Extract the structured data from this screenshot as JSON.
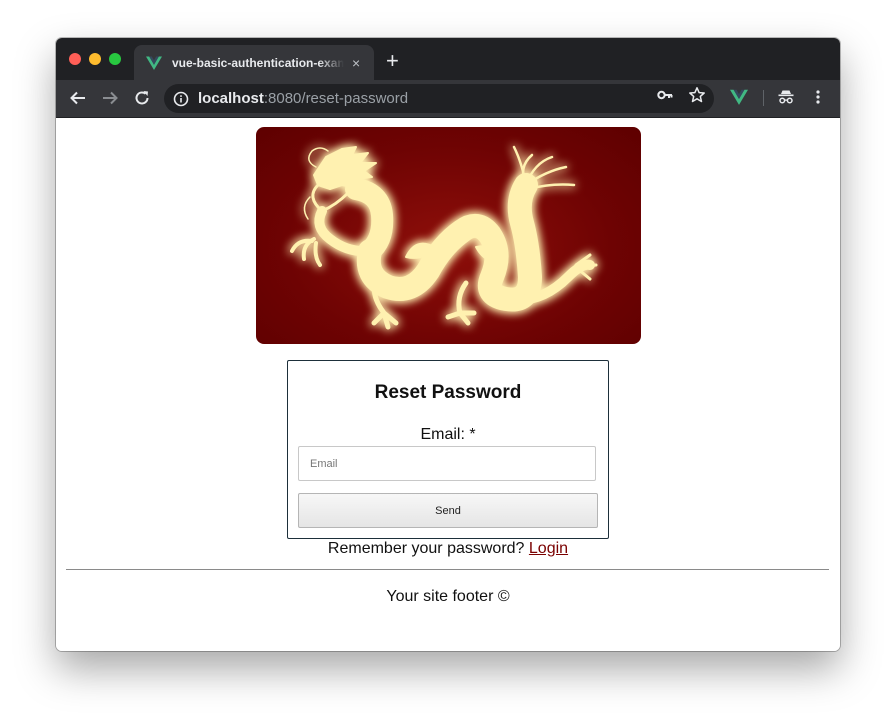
{
  "browser": {
    "tab_title": "vue-basic-authentication-example",
    "tab_close_glyph": "×",
    "new_tab_glyph": "+",
    "url_host": "localhost",
    "url_rest": ":8080/reset-password",
    "vue_logo_color": "#41b883"
  },
  "icons": {
    "back": "back-arrow-icon",
    "forward": "forward-arrow-icon",
    "reload": "reload-icon",
    "info": "info-icon",
    "key": "key-icon",
    "star": "star-icon",
    "vue_devtools": "vue-logo-icon",
    "incognito": "incognito-icon",
    "menu": "more-vertical-icon"
  },
  "page": {
    "hero": {
      "bg_color": "#6e0303",
      "dragon_color": "#fff1b0"
    },
    "card": {
      "title": "Reset Password",
      "email_label": "Email: *",
      "email_placeholder": "Email",
      "email_value": "",
      "send_label": "Send"
    },
    "remember_text": "Remember your password?",
    "login_link": "Login",
    "footer_text": "Your site footer ©"
  }
}
